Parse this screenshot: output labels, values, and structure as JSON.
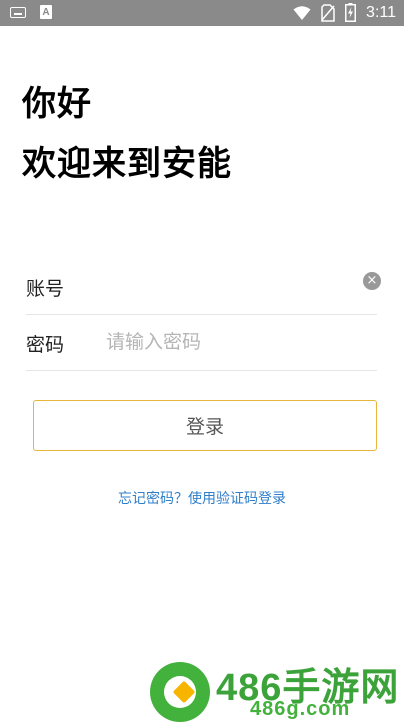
{
  "status_bar": {
    "time": "3:11",
    "left_icons": [
      "keyboard-icon",
      "a-notification-icon"
    ],
    "right_icons": [
      "wifi-icon",
      "no-sim-icon",
      "battery-charging-icon"
    ],
    "a_icon_text": "A"
  },
  "greeting": {
    "line1": "你好",
    "line2": "欢迎来到安能"
  },
  "form": {
    "account_label": "账号",
    "account_value": "",
    "password_label": "密码",
    "password_placeholder": "请输入密码",
    "clear_glyph": "×"
  },
  "login_button": "登录",
  "forgot_link": "忘记密码？使用验证码登录",
  "watermark": {
    "brand": "486手游网",
    "domain": "486g.com",
    "colors": {
      "green": "#43b23c",
      "yellow": "#f7b500"
    }
  },
  "colors": {
    "status_bar": "#8a8a8a",
    "button_border": "#e6b53a",
    "link": "#2f7ec9"
  }
}
